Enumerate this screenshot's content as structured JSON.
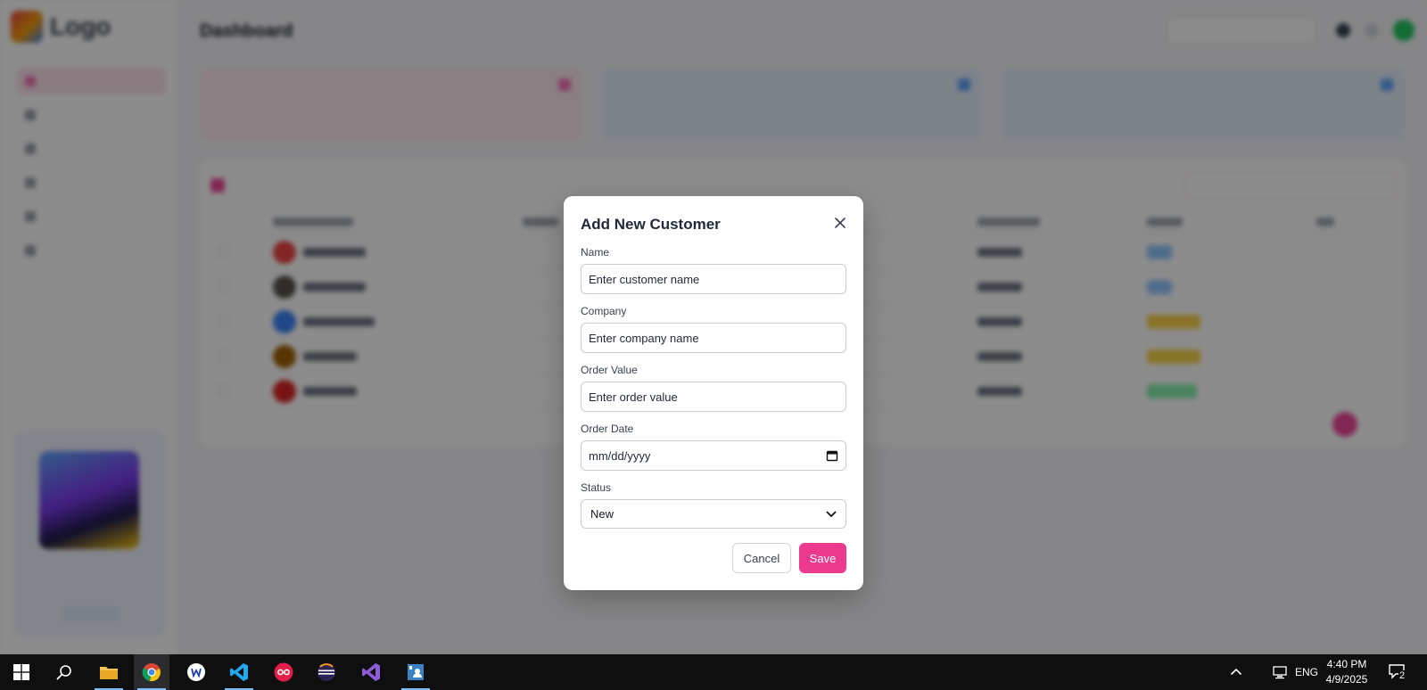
{
  "background": {
    "logo_text": "Logo",
    "page_title": "Dashboard"
  },
  "modal": {
    "title": "Add New Customer",
    "fields": {
      "name": {
        "label": "Name",
        "placeholder": "Enter customer name"
      },
      "company": {
        "label": "Company",
        "placeholder": "Enter company name"
      },
      "order_value": {
        "label": "Order Value",
        "placeholder": "Enter order value"
      },
      "order_date": {
        "label": "Order Date",
        "placeholder": "mm/dd/yyyy"
      },
      "status": {
        "label": "Status",
        "selected": "New"
      }
    },
    "cancel_label": "Cancel",
    "save_label": "Save",
    "accent_color": "#ec3a8f"
  },
  "taskbar": {
    "apps": [
      "windows-start",
      "search",
      "file-explorer",
      "chrome",
      "wordpad",
      "vscode",
      "app-oo",
      "eclipse",
      "visual-studio",
      "contacts"
    ],
    "language": "ENG",
    "time": "4:40 PM",
    "date": "4/9/2025",
    "notification_count": "2"
  }
}
